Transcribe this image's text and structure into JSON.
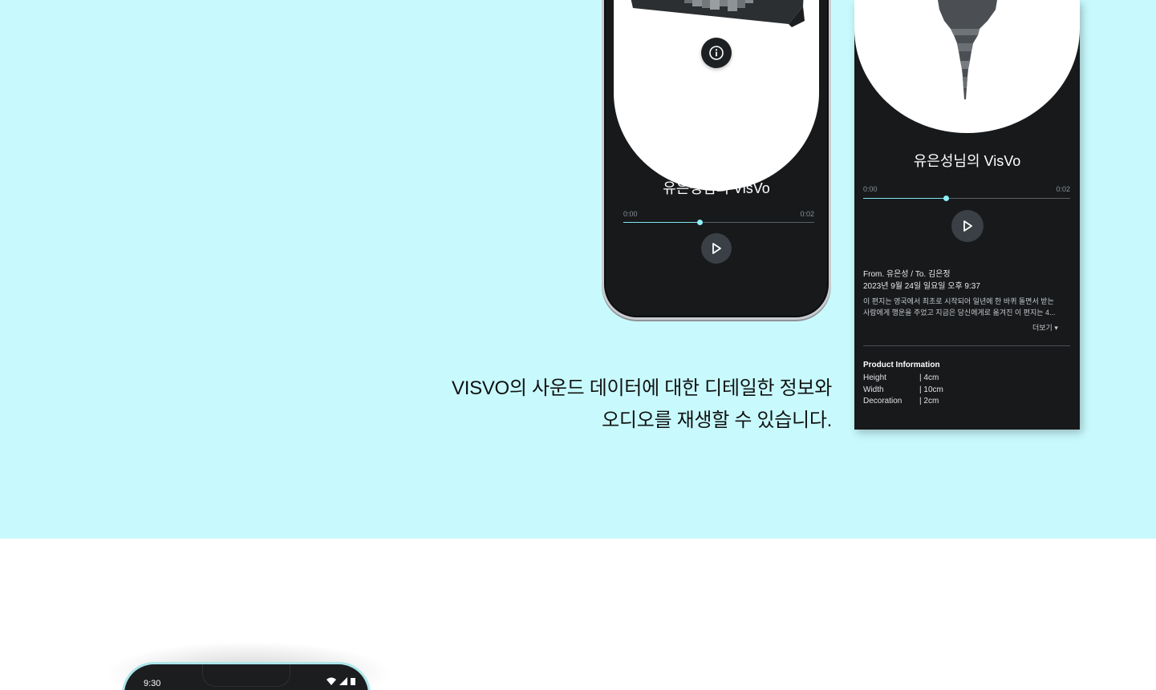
{
  "phone": {
    "title": "유은성님의 VisVo",
    "time_start": "0:00",
    "time_end": "0:02",
    "progress": 0.4
  },
  "card": {
    "title": "유은성님의 VisVo",
    "time_start": "0:00",
    "time_end": "0:02",
    "progress": 0.4,
    "from_to": "From. 유은성 / To. 김은정",
    "date": "2023년 9월 24일 일요일 오후 9:37",
    "description_line1": "이 편지는 영국에서 최초로 시작되어 일년에 한 바퀴 돌면서 받는",
    "description_line2": "사람에게 행운을 주었고 지금은 당신에게로 옮겨진 이 편지는 4...",
    "more_label": "더보기 ▾",
    "product_info_title": "Product Information",
    "product_info": [
      {
        "label": "Height",
        "value": "| 4cm"
      },
      {
        "label": "Width",
        "value": "| 10cm"
      },
      {
        "label": "Decoration",
        "value": "| 2cm"
      }
    ]
  },
  "caption": {
    "line1": "VISVO의 사운드 데이터에 대한 디테일한 정보와",
    "line2": "오디오를 재생할 수 있습니다."
  },
  "bottom_phone": {
    "status_time": "9:30"
  },
  "colors": {
    "section_bg": "#c8fafd",
    "accent": "#8ff0f8",
    "dark_panel": "#17191b"
  },
  "icons": [
    "info-icon",
    "play-icon",
    "wifi-icon",
    "signal-icon",
    "battery-icon"
  ]
}
